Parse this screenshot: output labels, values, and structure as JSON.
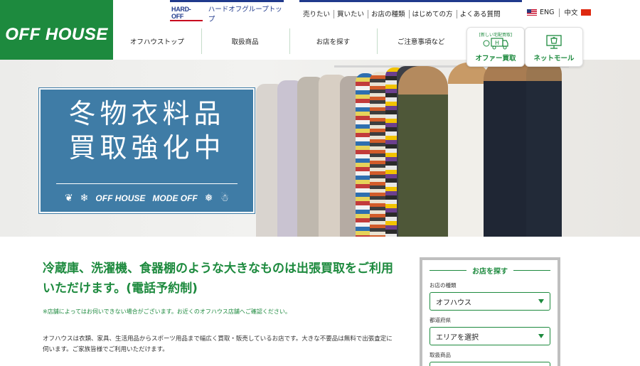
{
  "logo": {
    "text": "OFF HOUSE"
  },
  "util": {
    "hardoff_badge": "HARD-OFF",
    "hardoff_link": "ハードオフグループトップ",
    "links": [
      "売りたい",
      "買いたい",
      "お店の種類",
      "はじめての方",
      "よくある質問"
    ],
    "lang_en": "ENG",
    "lang_zh": "中文"
  },
  "nav": [
    "オフハウストップ",
    "取扱商品",
    "お店を探す",
    "ご注意事項など"
  ],
  "side": {
    "offer_top": "[新しい宅配買取]",
    "offer_label": "オファー買取",
    "net_label": "ネットモール"
  },
  "hero": {
    "line1": "冬物衣料品",
    "line2": "買取強化中",
    "brand1": "OFF HOUSE",
    "brand2": "MODE OFF"
  },
  "content": {
    "headline": "冷蔵庫、洗濯機、食器棚のような大きなものは出張買取をご利用いただけます。(電話予約制)",
    "note": "※店舗によってはお伺いできない場合がございます。お近くのオフハウス店舗へご確認ください。",
    "body": "オフハウスは衣類、家具、生活用品からスポーツ用品まで幅広く買取・販売しているお店です。大きな不要品は無料で出張査定に伺います。ご家族皆様でご利用いただけます。"
  },
  "finder": {
    "title": "お店を探す",
    "label_type": "お店の種類",
    "value_type": "オフハウス",
    "label_pref": "都道府県",
    "value_pref": "エリアを選択",
    "label_goods": "取扱商品"
  },
  "colors": {
    "brand_green": "#1d8a3e",
    "hero_blue": "#3f7ca6",
    "hardoff_navy": "#203a8c"
  }
}
